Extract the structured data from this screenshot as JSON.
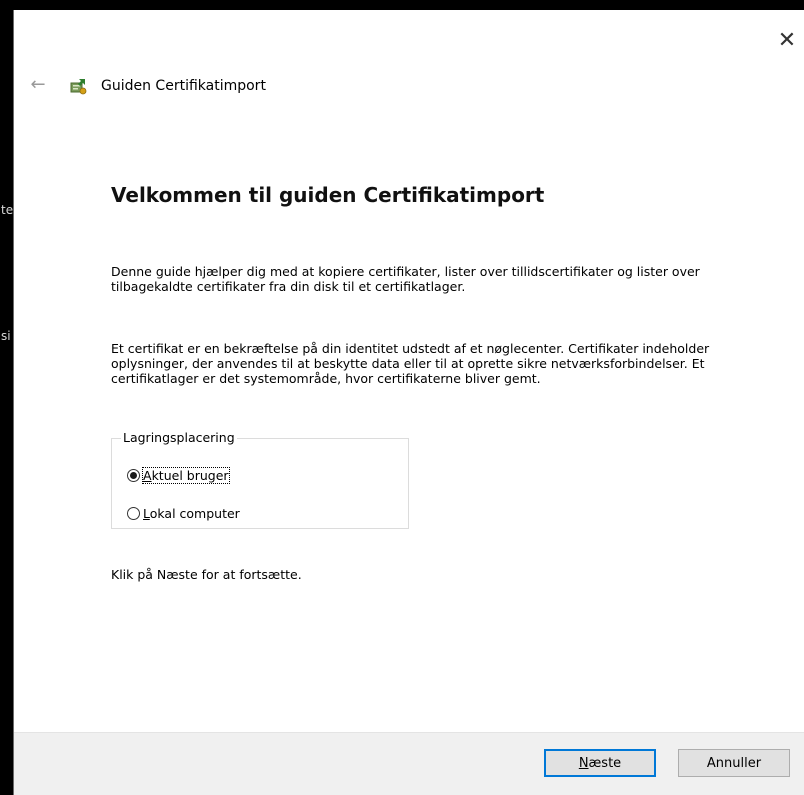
{
  "backdrop": {
    "fragment_1": "te",
    "fragment_2": "si"
  },
  "window": {
    "close_glyph": "✕",
    "back_glyph": "←",
    "title": "Guiden Certifikatimport"
  },
  "content": {
    "heading": "Velkommen til guiden Certifikatimport",
    "paragraph_1": "Denne guide hjælper dig med at kopiere certifikater, lister over tillidscertifikater og lister over tilbagekaldte certifikater fra din disk til et certifikatlager.",
    "paragraph_2": "Et certifikat er en bekræftelse på din identitet udstedt af et nøglecenter. Certifikater indeholder oplysninger, der anvendes til at beskytte data eller til at oprette sikre netværksforbindelser. Et certifikatlager er det systemområde, hvor certifikaterne bliver gemt.",
    "store_location": {
      "legend": "Lagringsplacering",
      "options": [
        {
          "label": "Aktuel bruger",
          "selected": true
        },
        {
          "label": "Lokal computer",
          "selected": false
        }
      ]
    },
    "continue_hint": "Klik på Næste for at fortsætte."
  },
  "footer": {
    "next_label": "Næste",
    "cancel_label": "Annuller"
  },
  "colors": {
    "accent": "#0078d7",
    "footer_bg": "#f0f0f0",
    "button_bg": "#e1e1e1"
  },
  "icons": {
    "back": "back-arrow-icon",
    "wizard": "certificate-wizard-icon",
    "close": "close-icon"
  }
}
